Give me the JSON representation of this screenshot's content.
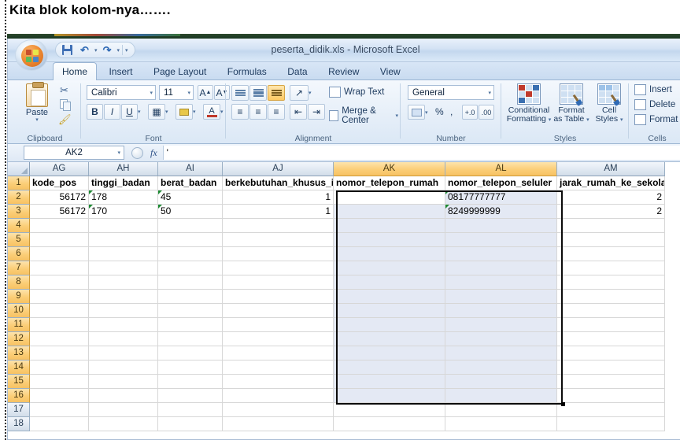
{
  "document": {
    "heading": "Kita blok kolom-nya……."
  },
  "window": {
    "title": "peserta_didik.xls - Microsoft Excel",
    "office_button": "Office Button",
    "quick_access": [
      {
        "name": "save",
        "label": "Save",
        "glyph": ""
      },
      {
        "name": "undo",
        "label": "Undo",
        "glyph": "↰"
      },
      {
        "name": "redo",
        "label": "Redo",
        "glyph": "↱"
      },
      {
        "name": "customize",
        "label": "Customize Quick Access Toolbar",
        "glyph": "▾"
      }
    ]
  },
  "ribbon": {
    "tabs": [
      {
        "label": "Home",
        "active": true
      },
      {
        "label": "Insert",
        "active": false
      },
      {
        "label": "Page Layout",
        "active": false
      },
      {
        "label": "Formulas",
        "active": false
      },
      {
        "label": "Data",
        "active": false
      },
      {
        "label": "Review",
        "active": false
      },
      {
        "label": "View",
        "active": false
      }
    ],
    "groups": {
      "clipboard": {
        "label": "Clipboard",
        "paste": "Paste",
        "cut": "Cut",
        "copy": "Copy",
        "format_painter": "Format Painter"
      },
      "font": {
        "label": "Font",
        "font_name": "Calibri",
        "font_size": "11",
        "grow_font": "A",
        "shrink_font": "A",
        "bold": "B",
        "italic": "I",
        "underline": "U",
        "borders": "Borders",
        "fill_color": "Fill Color",
        "font_color": "A"
      },
      "alignment": {
        "label": "Alignment",
        "wrap_text": "Wrap Text",
        "merge_center": "Merge & Center",
        "align_top": "Top Align",
        "align_middle": "Middle Align",
        "align_bottom": "Bottom Align",
        "orientation": "Orientation",
        "align_left": "Align Text Left",
        "align_center": "Center",
        "align_right": "Align Text Right",
        "decrease_indent": "Decrease Indent",
        "increase_indent": "Increase Indent"
      },
      "number": {
        "label": "Number",
        "format": "General",
        "accounting": "Accounting Number Format",
        "percent": "%",
        "comma": ",",
        "increase_decimal": "+.0",
        "decrease_decimal": ".00"
      },
      "styles": {
        "label": "Styles",
        "conditional_formatting": "Conditional\nFormatting",
        "conditional_formatting_l1": "Conditional",
        "conditional_formatting_l2": "Formatting",
        "format_as_table_l1": "Format",
        "format_as_table_l2": "as Table",
        "cell_styles_l1": "Cell",
        "cell_styles_l2": "Styles"
      },
      "cells": {
        "label": "Cells",
        "insert": "Insert",
        "delete": "Delete",
        "format": "Format"
      }
    }
  },
  "formula_bar": {
    "name_box": "AK2",
    "formula": "'",
    "cancel": "Cancel",
    "enter": "Enter",
    "insert_function": "fx"
  },
  "sheet": {
    "columns": [
      {
        "letter": "AG",
        "field": "kode_pos",
        "width": 75,
        "selected": false
      },
      {
        "letter": "AH",
        "field": "tinggi_badan",
        "width": 88,
        "selected": false
      },
      {
        "letter": "AI",
        "field": "berat_badan",
        "width": 82,
        "selected": false
      },
      {
        "letter": "AJ",
        "field": "berkebutuhan_khusus_id",
        "width": 141,
        "selected": false
      },
      {
        "letter": "AK",
        "field": "nomor_telepon_rumah",
        "width": 142,
        "selected": true
      },
      {
        "letter": "AL",
        "field": "nomor_telepon_seluler",
        "width": 142,
        "selected": true
      },
      {
        "letter": "AM",
        "field": "jarak_rumah_ke_sekolah",
        "width": 137,
        "selected": false
      }
    ],
    "rows": [
      {
        "number": "1",
        "selected": true,
        "header": true,
        "cells": [
          {
            "value": "kode_pos",
            "align": "left",
            "marker": false
          },
          {
            "value": "tinggi_badan",
            "align": "left",
            "marker": false
          },
          {
            "value": "berat_badan",
            "align": "left",
            "marker": false
          },
          {
            "value": "berkebutuhan_khusus_id",
            "align": "left",
            "marker": false
          },
          {
            "value": "nomor_telepon_rumah",
            "align": "left",
            "marker": false
          },
          {
            "value": "nomor_telepon_seluler",
            "align": "left",
            "marker": false
          },
          {
            "value": "jarak_rumah_ke_sekolah",
            "align": "left",
            "marker": false
          }
        ]
      },
      {
        "number": "2",
        "selected": true,
        "header": false,
        "cells": [
          {
            "value": "56172",
            "align": "right",
            "marker": false
          },
          {
            "value": "178",
            "align": "left",
            "marker": true
          },
          {
            "value": "45",
            "align": "left",
            "marker": true
          },
          {
            "value": "1",
            "align": "right",
            "marker": false
          },
          {
            "value": "",
            "align": "left",
            "marker": false
          },
          {
            "value": "08177777777",
            "align": "left",
            "marker": true
          },
          {
            "value": "2",
            "align": "right",
            "marker": false
          }
        ]
      },
      {
        "number": "3",
        "selected": true,
        "header": false,
        "cells": [
          {
            "value": "56172",
            "align": "right",
            "marker": false
          },
          {
            "value": "170",
            "align": "left",
            "marker": true
          },
          {
            "value": "50",
            "align": "left",
            "marker": true
          },
          {
            "value": "1",
            "align": "right",
            "marker": false
          },
          {
            "value": "",
            "align": "left",
            "marker": false
          },
          {
            "value": "8249999999",
            "align": "left",
            "marker": true
          },
          {
            "value": "2",
            "align": "right",
            "marker": false
          }
        ]
      },
      {
        "number": "4",
        "selected": true,
        "header": false,
        "cells": []
      },
      {
        "number": "5",
        "selected": true,
        "header": false,
        "cells": []
      },
      {
        "number": "6",
        "selected": true,
        "header": false,
        "cells": []
      },
      {
        "number": "7",
        "selected": true,
        "header": false,
        "cells": []
      },
      {
        "number": "8",
        "selected": true,
        "header": false,
        "cells": []
      },
      {
        "number": "9",
        "selected": true,
        "header": false,
        "cells": []
      },
      {
        "number": "10",
        "selected": true,
        "header": false,
        "cells": []
      },
      {
        "number": "11",
        "selected": true,
        "header": false,
        "cells": []
      },
      {
        "number": "12",
        "selected": true,
        "header": false,
        "cells": []
      },
      {
        "number": "13",
        "selected": true,
        "header": false,
        "cells": []
      },
      {
        "number": "14",
        "selected": true,
        "header": false,
        "cells": []
      },
      {
        "number": "15",
        "selected": true,
        "header": false,
        "cells": []
      },
      {
        "number": "16",
        "selected": true,
        "header": false,
        "cells": []
      },
      {
        "number": "17",
        "selected": false,
        "header": false,
        "cells": []
      },
      {
        "number": "18",
        "selected": false,
        "header": false,
        "cells": []
      }
    ],
    "selection": {
      "range": "AK2:AL16",
      "first_col_index": 4,
      "last_col_index": 5,
      "first_row_index": 1,
      "last_row_index": 15
    }
  },
  "colors": {
    "selected_header": "#fbce77",
    "selection_fill": "#e4e9f4",
    "selection_border": "#0b0b0b",
    "comment_marker": "#1d8a33",
    "ribbon_bg": "#e5eef8",
    "titlebar_text": "#3c4d63"
  }
}
